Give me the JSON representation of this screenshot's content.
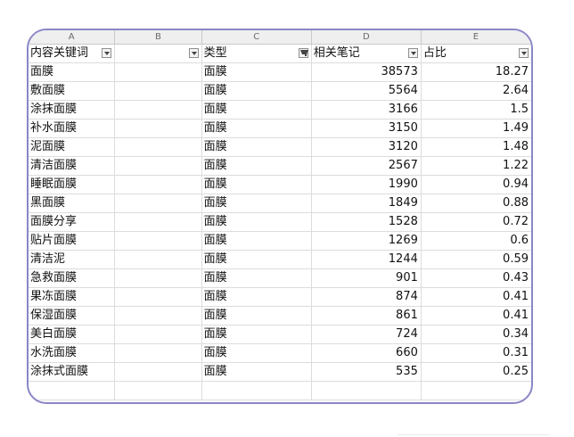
{
  "columns": [
    "A",
    "B",
    "C",
    "D",
    "E"
  ],
  "headers": {
    "a": "内容关键词",
    "b": "",
    "c": "类型",
    "d": "相关笔记",
    "e": "占比"
  },
  "rows": [
    {
      "keyword": "面膜",
      "type": "面膜",
      "notes": "38573",
      "share": "18.27"
    },
    {
      "keyword": "敷面膜",
      "type": "面膜",
      "notes": "5564",
      "share": "2.64"
    },
    {
      "keyword": "涂抹面膜",
      "type": "面膜",
      "notes": "3166",
      "share": "1.5"
    },
    {
      "keyword": "补水面膜",
      "type": "面膜",
      "notes": "3150",
      "share": "1.49"
    },
    {
      "keyword": "泥面膜",
      "type": "面膜",
      "notes": "3120",
      "share": "1.48"
    },
    {
      "keyword": "清洁面膜",
      "type": "面膜",
      "notes": "2567",
      "share": "1.22"
    },
    {
      "keyword": "睡眠面膜",
      "type": "面膜",
      "notes": "1990",
      "share": "0.94"
    },
    {
      "keyword": "黑面膜",
      "type": "面膜",
      "notes": "1849",
      "share": "0.88"
    },
    {
      "keyword": "面膜分享",
      "type": "面膜",
      "notes": "1528",
      "share": "0.72"
    },
    {
      "keyword": "贴片面膜",
      "type": "面膜",
      "notes": "1269",
      "share": "0.6"
    },
    {
      "keyword": "清洁泥",
      "type": "面膜",
      "notes": "1244",
      "share": "0.59"
    },
    {
      "keyword": "急救面膜",
      "type": "面膜",
      "notes": "901",
      "share": "0.43"
    },
    {
      "keyword": "果冻面膜",
      "type": "面膜",
      "notes": "874",
      "share": "0.41"
    },
    {
      "keyword": "保湿面膜",
      "type": "面膜",
      "notes": "861",
      "share": "0.41"
    },
    {
      "keyword": "美白面膜",
      "type": "面膜",
      "notes": "724",
      "share": "0.34"
    },
    {
      "keyword": "水洗面膜",
      "type": "面膜",
      "notes": "660",
      "share": "0.31"
    },
    {
      "keyword": "涂抹式面膜",
      "type": "面膜",
      "notes": "535",
      "share": "0.25"
    }
  ],
  "filter_icons": {
    "a": "dropdown-arrow-icon",
    "b": "dropdown-arrow-icon",
    "c": "filter-active-icon",
    "d": "dropdown-arrow-icon",
    "e": "dropdown-arrow-icon"
  },
  "colors": {
    "frame_border": "#8a86c7",
    "grid_line": "#dcdcdc",
    "column_header_bg": "#efefef"
  }
}
